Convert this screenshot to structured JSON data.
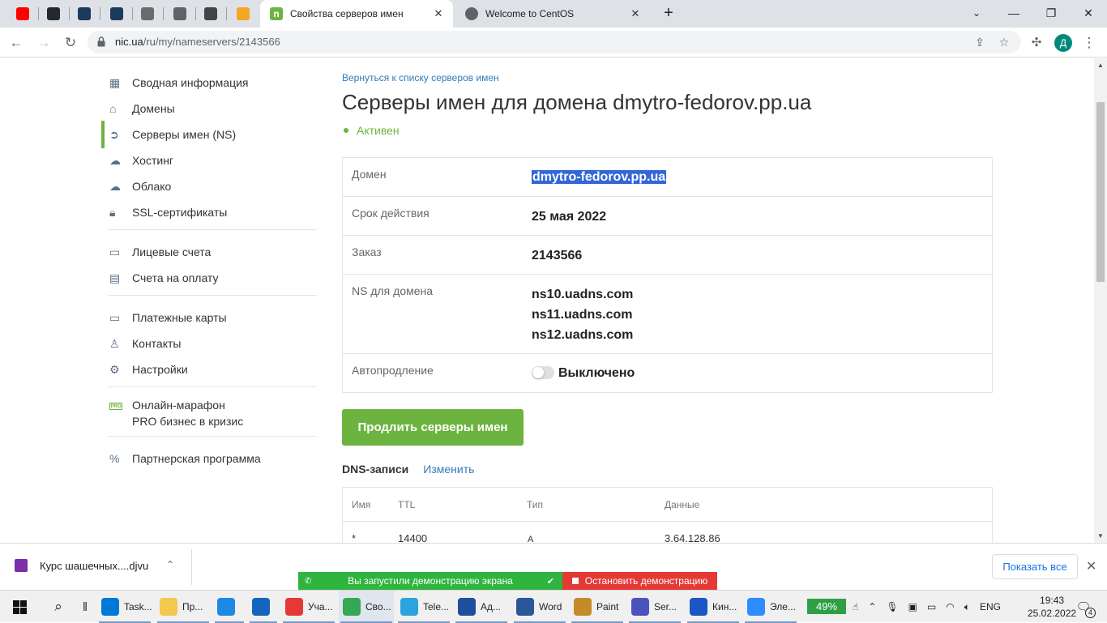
{
  "browser": {
    "pinned_tabs": [
      {
        "icon": "youtube-icon",
        "color": "#ff0000"
      },
      {
        "icon": "github-icon",
        "color": "#24292e"
      },
      {
        "icon": "hexagon-app-icon",
        "color": "#1c3a5e"
      },
      {
        "icon": "hexagon-app-icon-2",
        "color": "#1c3a5e"
      },
      {
        "icon": "bookmark-page-icon",
        "color": "#6b6b6b"
      },
      {
        "icon": "globe-icon",
        "color": "#5f6368"
      },
      {
        "icon": "v-letter-icon",
        "color": "#444444"
      },
      {
        "icon": "box-icon",
        "color": "#f5a623"
      }
    ],
    "tabs": [
      {
        "title": "Свойства серверов имен",
        "active": true,
        "favicon_color": "#6db33f"
      },
      {
        "title": "Welcome to CentOS",
        "active": false,
        "favicon_color": "#5f6368"
      }
    ],
    "url_host": "nic.ua",
    "url_path": "/ru/my/nameservers/2143566",
    "profile_initial": "Д"
  },
  "sidebar": {
    "groups": [
      [
        {
          "label": "Сводная информация",
          "icon": "dashboard-grid-icon"
        },
        {
          "label": "Домены",
          "icon": "home-icon"
        },
        {
          "label": "Серверы имен (NS)",
          "icon": "arrow-circle-icon",
          "active": true
        },
        {
          "label": "Хостинг",
          "icon": "cloud-icon"
        },
        {
          "label": "Облако",
          "icon": "cloud-server-icon"
        },
        {
          "label": "SSL-сертификаты",
          "icon": "lock-icon"
        }
      ],
      [
        {
          "label": "Лицевые счета",
          "icon": "wallet-icon"
        },
        {
          "label": "Счета на оплату",
          "icon": "invoice-icon"
        }
      ],
      [
        {
          "label": "Платежные карты",
          "icon": "card-icon"
        },
        {
          "label": "Контакты",
          "icon": "user-icon"
        },
        {
          "label": "Настройки",
          "icon": "gear-icon"
        }
      ],
      [
        {
          "label": "Онлайн-марафон",
          "label2": "PRO бизнес в кризис",
          "icon": "pro-badge-icon"
        }
      ],
      [
        {
          "label": "Партнерская программа",
          "icon": "percent-icon"
        }
      ]
    ]
  },
  "main": {
    "back_link": "Вернуться к списку серверов имен",
    "title": "Серверы имен для домена dmytro-fedorov.pp.ua",
    "status": "Активен",
    "info": {
      "domain_label": "Домен",
      "domain_value": "dmytro-fedorov.pp.ua",
      "expiry_label": "Срок действия",
      "expiry_value": "25 мая 2022",
      "order_label": "Заказ",
      "order_value": "2143566",
      "ns_label": "NS для домена",
      "ns_values": [
        "ns10.uadns.com",
        "ns11.uadns.com",
        "ns12.uadns.com"
      ],
      "autorenew_label": "Автопродление",
      "autorenew_value": "Выключено"
    },
    "renew_button": "Продлить серверы имен",
    "dns_title": "DNS-записи",
    "dns_edit": "Изменить",
    "dns_columns": [
      "Имя",
      "TTL",
      "Тип",
      "Данные"
    ],
    "dns_rows": [
      {
        "name": "*",
        "ttl": "14400",
        "type": "A",
        "data": "3.64.128.86"
      }
    ]
  },
  "downloads": {
    "file": "Курс шашечных....djvu",
    "show_all": "Показать все"
  },
  "screenshare": {
    "message": "Вы запустили демонстрацию экрана",
    "stop": "Остановить демонстрацию"
  },
  "taskbar": {
    "apps": [
      {
        "label": "Task...",
        "color": "#0078d7"
      },
      {
        "label": "Пр...",
        "color": "#f2c94c"
      },
      {
        "label": "",
        "color": "#1e88e5"
      },
      {
        "label": "",
        "color": "#1565c0"
      },
      {
        "label": "Уча...",
        "color": "#e53935"
      },
      {
        "label": "Сво...",
        "color": "#34a853"
      },
      {
        "label": "Tele...",
        "color": "#2aa3de"
      },
      {
        "label": "Ад...",
        "color": "#1f4e9c"
      },
      {
        "label": "Word",
        "color": "#2b579a"
      },
      {
        "label": "Paint",
        "color": "#c58b2b"
      },
      {
        "label": "Ser...",
        "color": "#4b53bc"
      },
      {
        "label": "Кин...",
        "color": "#1a56c4"
      },
      {
        "label": "Эле...",
        "color": "#2d8cff"
      }
    ],
    "battery": "49%",
    "lang": "ENG",
    "time": "19:43",
    "date": "25.02.2022",
    "notifications": "4"
  }
}
